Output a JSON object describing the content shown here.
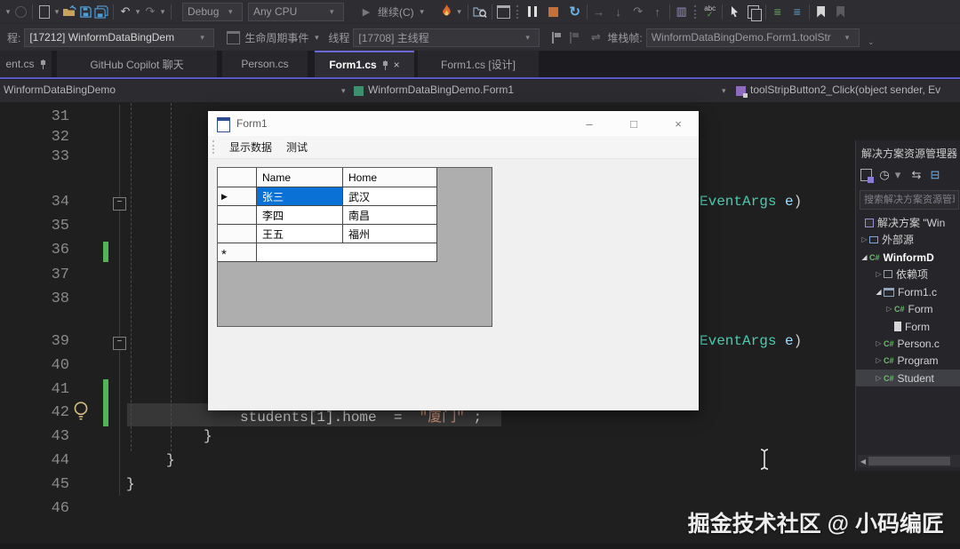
{
  "toolbar1": {
    "debug": "Debug",
    "platform": "Any CPU",
    "continue_label": "继续(C)",
    "abc_label": "abc",
    "abc_check": "✓"
  },
  "toolbar2": {
    "process_label": "程:",
    "process_value": "[17212] WinformDataBingDem",
    "lifecycle_label": "生命周期事件",
    "thread_label": "线程",
    "thread_value": "[17708] 主线程",
    "frame_label": "堆栈帧:",
    "frame_value": "WinformDataBingDemo.Form1.toolStr"
  },
  "tabs": {
    "tab1": "ent.cs",
    "tab2": "GitHub Copilot 聊天",
    "tab3": "Person.cs",
    "tab4": "Form1.cs",
    "tab5": "Form1.cs [设计]"
  },
  "breadcrumb": {
    "project": "WinformDataBingDemo",
    "type": "WinformDataBingDemo.Form1",
    "member": "toolStripButton2_Click(object sender, Ev"
  },
  "editor": {
    "line_numbers": [
      "31",
      "32",
      "33",
      "34",
      "35",
      "36",
      "37",
      "38",
      "39",
      "40",
      "41",
      "42",
      "43",
      "44",
      "45",
      "46"
    ],
    "code": {
      "type_name": "EventArgs",
      "param": "e",
      "paren": ")",
      "lhs": "students[1].home",
      "op": "=",
      "str": "\"厦门\"",
      "semi": ";",
      "brace": "}"
    },
    "fold_minus": "−"
  },
  "form1": {
    "title": "Form1",
    "menu": [
      "显示数据",
      "测试"
    ],
    "grid": {
      "headers": [
        "Name",
        "Home"
      ],
      "rows": [
        [
          "张三",
          "武汉"
        ],
        [
          "李四",
          "南昌"
        ],
        [
          "王五",
          "福州"
        ]
      ],
      "current_row_marker": "▶",
      "new_row_marker": "*"
    },
    "buttons": {
      "minimize": "–",
      "maximize": "□",
      "close": "×"
    }
  },
  "solution_explorer": {
    "title": "解决方案资源管理器",
    "search_placeholder": "搜索解决方案资源管理器",
    "csharp": "C#",
    "items": [
      {
        "label": "解决方案 \"Win"
      },
      {
        "label": "外部源"
      },
      {
        "label": "WinformD"
      },
      {
        "label": "依赖项"
      },
      {
        "label": "Form1.c"
      },
      {
        "label": "Form"
      },
      {
        "label": "Form"
      },
      {
        "label": "Person.c"
      },
      {
        "label": "Program"
      },
      {
        "label": "Student"
      }
    ]
  },
  "watermark": "掘金技术社区 @ 小码编匠",
  "glyphs": {
    "caret": "▾",
    "overflow": "⌄",
    "undo": "↶",
    "redo": "↷",
    "play": "▶",
    "restart": "↻",
    "step_over": "→",
    "step_into": "↓",
    "step_back": "↷",
    "step_out": "↑",
    "stacks": "▥",
    "indent": "≡",
    "clock": "◷",
    "sync": "⇆",
    "collapse_all": "⊟",
    "swap": "⇌",
    "collapsed": "▷",
    "expanded": "◢",
    "scroll_left": "◀"
  }
}
